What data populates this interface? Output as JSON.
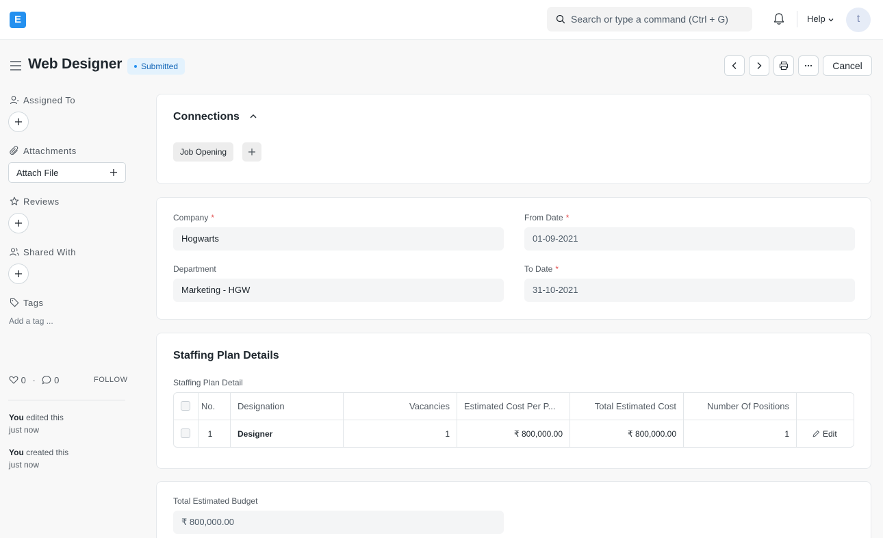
{
  "navbar": {
    "logo_letter": "E",
    "search_placeholder": "Search or type a command (Ctrl + G)",
    "help_label": "Help",
    "avatar_initial": "t"
  },
  "page": {
    "title": "Web Designer",
    "status": "Submitted",
    "cancel_label": "Cancel"
  },
  "sidebar": {
    "assigned_to": "Assigned To",
    "attachments": "Attachments",
    "attach_file": "Attach File",
    "reviews": "Reviews",
    "shared_with": "Shared With",
    "tags": "Tags",
    "add_tag": "Add a tag ...",
    "likes_count": "0",
    "comments_count": "0",
    "separator": "·",
    "follow": "FOLLOW",
    "activity": [
      {
        "user": "You",
        "text": "edited this",
        "time": "just now"
      },
      {
        "user": "You",
        "text": "created this",
        "time": "just now"
      }
    ]
  },
  "connections": {
    "title": "Connections",
    "chip": "Job Opening"
  },
  "details": {
    "company_label": "Company",
    "company_value": "Hogwarts",
    "department_label": "Department",
    "department_value": "Marketing - HGW",
    "from_date_label": "From Date",
    "from_date_value": "01-09-2021",
    "to_date_label": "To Date",
    "to_date_value": "31-10-2021",
    "required_mark": "*"
  },
  "staffing": {
    "title": "Staffing Plan Details",
    "table_label": "Staffing Plan Detail",
    "columns": [
      "No.",
      "Designation",
      "Vacancies",
      "Estimated Cost Per P...",
      "Total Estimated Cost",
      "Number Of Positions"
    ],
    "rows": [
      {
        "no": "1",
        "designation": "Designer",
        "vacancies": "1",
        "cost_per_position": "₹ 800,000.00",
        "total_cost": "₹ 800,000.00",
        "positions": "1",
        "edit": "Edit"
      }
    ]
  },
  "budget": {
    "label": "Total Estimated Budget",
    "value": "₹ 800,000.00"
  }
}
